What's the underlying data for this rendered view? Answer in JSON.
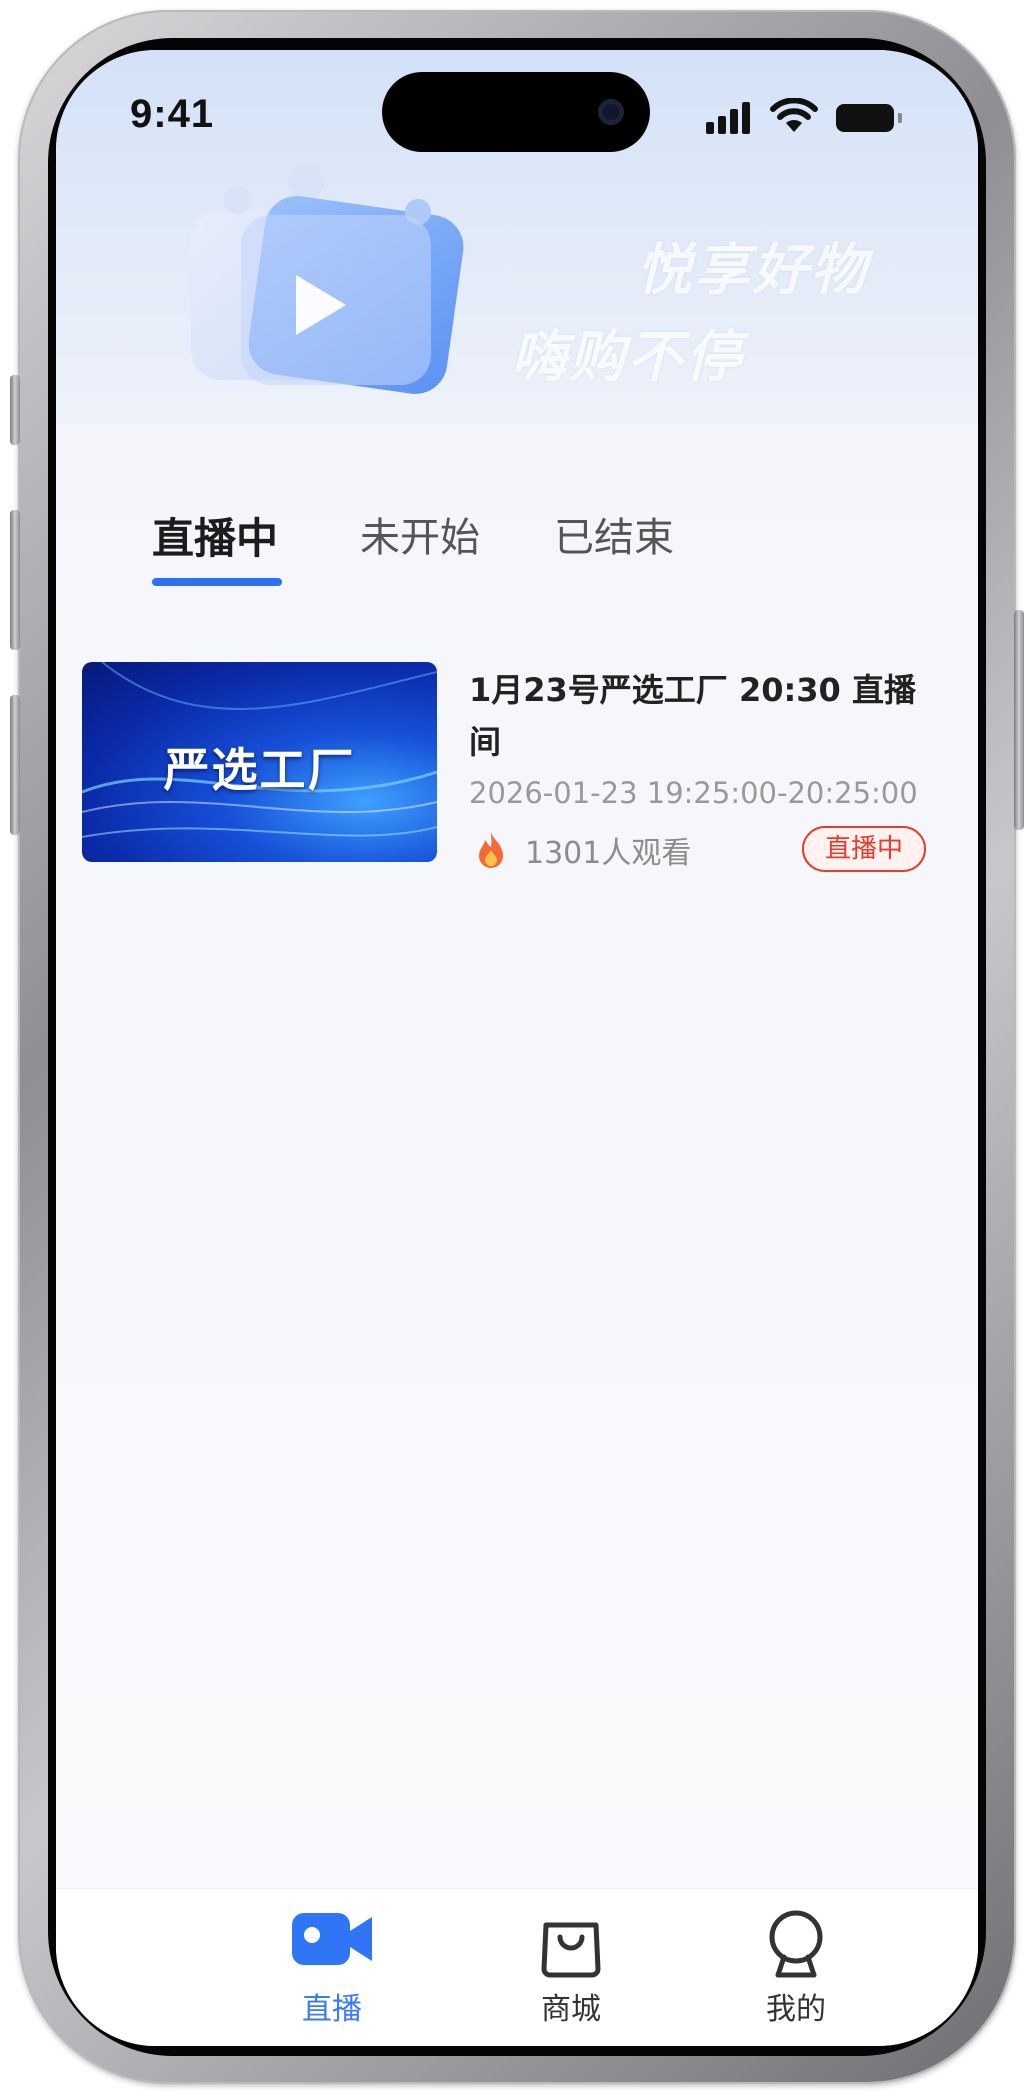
{
  "status_bar": {
    "time": "9:41"
  },
  "banner": {
    "slogan_line1": "悦享好物",
    "slogan_line2": "嗨购不停",
    "icon": "video-play-icon"
  },
  "tabs": [
    {
      "label": "直播中",
      "active": true
    },
    {
      "label": "未开始",
      "active": false
    },
    {
      "label": "已结束",
      "active": false
    }
  ],
  "streams": [
    {
      "thumbnail_text": "严选工厂",
      "title": "1月23号严选工厂 20:30 直播间",
      "time_range": "2026-01-23 19:25:00-20:25:00",
      "viewers": "1301人观看",
      "status": "直播中",
      "viewer_icon": "flame-icon"
    }
  ],
  "bottom_nav": [
    {
      "label": "直播",
      "icon": "video-camera-icon",
      "active": true
    },
    {
      "label": "商城",
      "icon": "shopping-bag-icon",
      "active": false
    },
    {
      "label": "我的",
      "icon": "profile-icon",
      "active": false
    }
  ],
  "colors": {
    "accent": "#2f6ff2",
    "live_red": "#e63b2e",
    "nav_active": "#3a7bf0"
  }
}
